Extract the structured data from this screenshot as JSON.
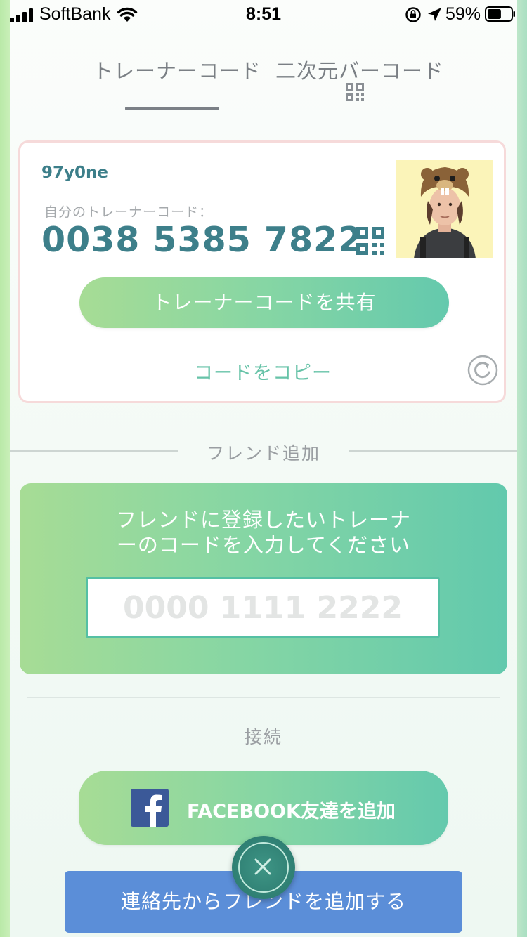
{
  "status_bar": {
    "carrier": "SoftBank",
    "time": "8:51",
    "battery_percent": "59%",
    "battery_level": 0.59
  },
  "tabs": [
    {
      "label": "トレーナーコード",
      "active": true
    },
    {
      "label": "二次元バーコード",
      "active": false
    }
  ],
  "trainer_card": {
    "name": "97y0ne",
    "code_label": "自分のトレーナーコード：",
    "code": "0038 5385 7822",
    "share_button": "トレーナーコードを共有",
    "copy_link": "コードをコピー"
  },
  "friend_add": {
    "section_title": "フレンド追加",
    "prompt_line1": "フレンドに登録したいトレーナ",
    "prompt_line2": "ーのコードを入力してください",
    "input_placeholder": "0000 1111 2222",
    "input_value": ""
  },
  "connect": {
    "section_title": "接続",
    "facebook_button": "FACEBOOK友達を追加",
    "contacts_button": "連絡先からフレンドを追加する"
  },
  "colors": {
    "accent_teal": "#3d7f8a",
    "green_start": "#a7dc95",
    "green_end": "#64c9ad",
    "contacts_blue": "#5b8ed8",
    "facebook_blue": "#3b5998"
  },
  "icons": [
    "signal-icon",
    "wifi-icon",
    "orientation-lock-icon",
    "location-arrow-icon",
    "battery-icon",
    "qr-code-icon",
    "refresh-icon",
    "facebook-logo-icon",
    "close-icon"
  ]
}
